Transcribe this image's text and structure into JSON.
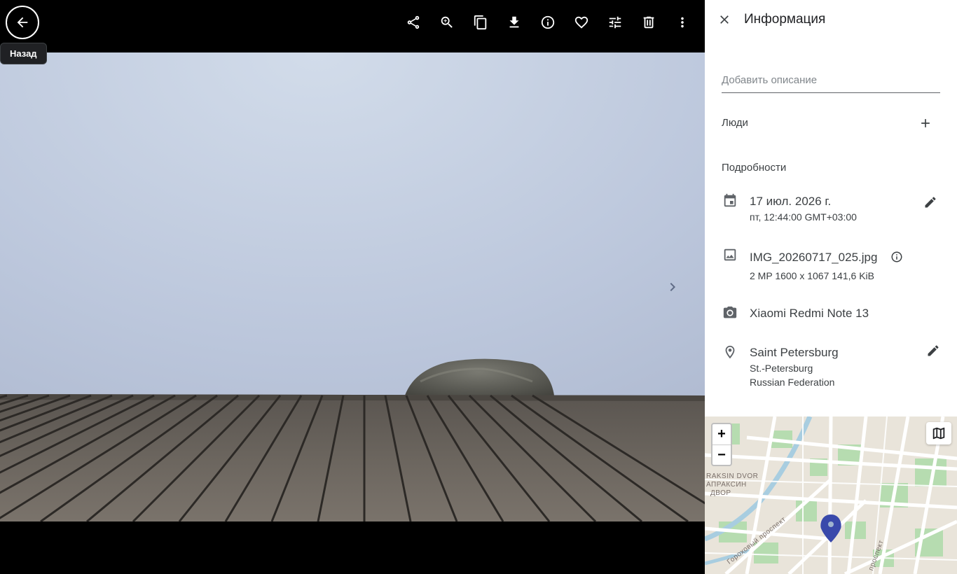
{
  "viewer": {
    "back_tooltip": "Назад",
    "toolbar": [
      {
        "name": "share-button",
        "icon": "share-icon"
      },
      {
        "name": "zoom-button",
        "icon": "zoom-in-icon"
      },
      {
        "name": "copy-button",
        "icon": "copy-icon"
      },
      {
        "name": "download-button",
        "icon": "download-icon"
      },
      {
        "name": "info-button",
        "icon": "info-icon"
      },
      {
        "name": "favorite-button",
        "icon": "heart-icon"
      },
      {
        "name": "edit-photo-button",
        "icon": "tune-icon"
      },
      {
        "name": "delete-button",
        "icon": "trash-icon"
      },
      {
        "name": "more-button",
        "icon": "more-vert-icon"
      }
    ]
  },
  "panel": {
    "title": "Информация",
    "description_placeholder": "Добавить описание",
    "people_label": "Люди",
    "details_label": "Подробности",
    "date": {
      "main": "17 июл. 2026 г.",
      "sub": "пт, 12:44:00 GMT+03:00"
    },
    "file": {
      "name": "IMG_20260717_025.jpg",
      "sub": "2 MP  1600 x 1067  141,6 KiB"
    },
    "camera": {
      "model": "Xiaomi Redmi Note 13"
    },
    "location": {
      "city": "Saint Petersburg",
      "region": "St.-Petersburg",
      "country": "Russian Federation"
    }
  },
  "map": {
    "zoom_in": "+",
    "zoom_out": "−",
    "labels": [
      "RAKSIN DVOR",
      "АПРАКСИН",
      "ДВОР"
    ],
    "street_labels": [
      "Гороховый проспект",
      "проспект"
    ],
    "pin_color": "#3949ab"
  }
}
